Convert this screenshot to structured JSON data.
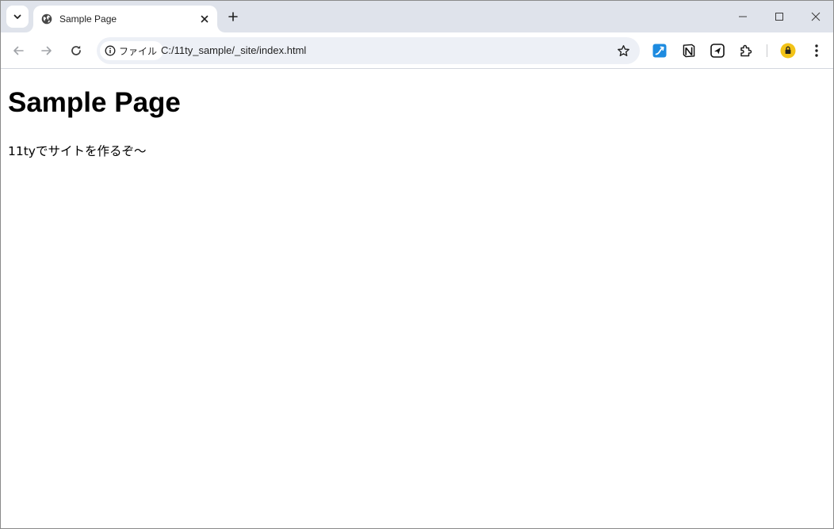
{
  "tab": {
    "title": "Sample Page"
  },
  "address_bar": {
    "site_chip_label": "ファイル",
    "url": "C:/11ty_sample/_site/index.html"
  },
  "icons": {
    "tab_search": "chevron-down-icon",
    "favicon": "globe-icon",
    "close": "close-icon",
    "new_tab": "plus-icon",
    "back": "arrow-left-icon",
    "forward": "arrow-right-icon",
    "reload": "reload-icon",
    "info": "info-icon",
    "bookmark": "star-icon",
    "extensions": "puzzle-icon",
    "menu": "kebab-menu-icon"
  },
  "colors": {
    "tabstrip_bg": "#dfe3eb",
    "omnibox_bg": "#edf0f6",
    "ext_blue": "#1d8be0",
    "profile_yellow": "#f2c318"
  },
  "page": {
    "heading": "Sample Page",
    "paragraph": "11tyでサイトを作るぞ〜"
  }
}
